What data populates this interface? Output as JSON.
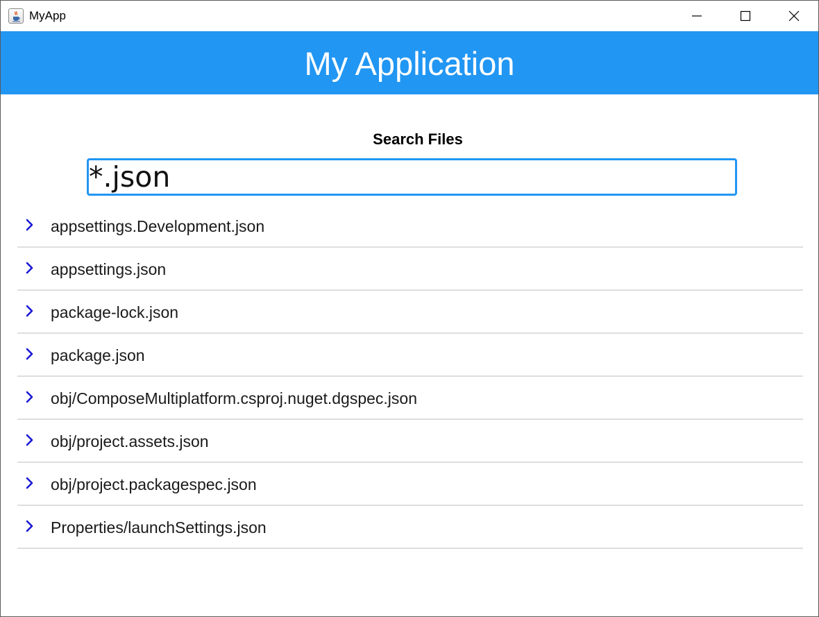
{
  "window": {
    "title": "MyApp"
  },
  "appbar": {
    "title": "My Application",
    "background": "#2196f3"
  },
  "search": {
    "label": "Search Files",
    "value": "*.json",
    "accent": "#2196f3"
  },
  "icons": {
    "app": "java-cup-icon",
    "minimize": "minimize-icon",
    "maximize": "maximize-icon",
    "close": "close-icon",
    "row": "chevron-right-icon"
  },
  "chevron_color": "#1a1ad6",
  "files": [
    {
      "name": "appsettings.Development.json"
    },
    {
      "name": "appsettings.json"
    },
    {
      "name": "package-lock.json"
    },
    {
      "name": "package.json"
    },
    {
      "name": "obj/ComposeMultiplatform.csproj.nuget.dgspec.json"
    },
    {
      "name": "obj/project.assets.json"
    },
    {
      "name": "obj/project.packagespec.json"
    },
    {
      "name": "Properties/launchSettings.json"
    }
  ]
}
